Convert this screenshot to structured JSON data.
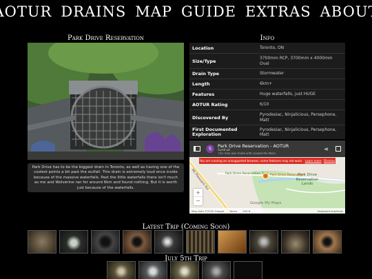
{
  "nav": [
    "AOTUR",
    "DRAINS",
    "MAP",
    "GUIDE",
    "EXTRAS",
    "ABOUT"
  ],
  "drain_title": "Park Drive Reservation",
  "info_title": "Info",
  "description": "Park Drive has to be the biggest drain in Toronto, as well as having one of the coolest points a bit past the outfall. This drain is extremely loud once inside because of the massive waterfalls. Past the little waterfalls there isn't much as me and Wolverine ran for around 6km and found nothing. But it is worth just because of the waterfalls.",
  "info": [
    {
      "label": "Location",
      "value": "Toronto, ON"
    },
    {
      "label": "Size/Type",
      "value": "3700mm RCP, 3700mm x 4000mm Oval"
    },
    {
      "label": "Drain Type",
      "value": "Stormwater"
    },
    {
      "label": "Length",
      "value": "6km+"
    },
    {
      "label": "Features",
      "value": "Huge waterfalls, just HUGE"
    },
    {
      "label": "AOTUR Rating",
      "value": "6/10"
    },
    {
      "label": "Discovered By",
      "value": "Pyrodesiac, Ninjalicious, Persephone, Matt"
    },
    {
      "label": "First Documented Exploration",
      "value": "Pyrodesiac, Ninjalicious, Persephone, Matt"
    }
  ],
  "map": {
    "avatar": "S",
    "title": "Park Drive Reservation - AOTUR",
    "subtitle": "Sunfruit",
    "partial_text": "This map was made with Google My Maps.",
    "warning": "You are running an unsupported browser, some features may not work.",
    "warning_link": "Learn more",
    "dismiss": "Dismiss",
    "road1": "Mt Pleasant Rd",
    "road2": "Park Drive Reservation Trail",
    "place": "Park Drive Reservation Lands",
    "marker_label": "Park Drive Reservation",
    "brand": "Google My Maps",
    "footer": [
      "Map data ©2020 Google",
      "Terms",
      "200 ft",
      "Keyboard shortcuts"
    ],
    "zoom_in": "+",
    "zoom_out": "−",
    "colors": {
      "marker": "#e8710a",
      "water": "#a8d7f0",
      "park": "#c5e3b5",
      "warning": "#d93025"
    }
  },
  "latest_title": "Latest Trip (Coming Soon)",
  "latest_thumb_count": 10,
  "july_title": "July 5th Trip",
  "july_thumb_count": 5
}
